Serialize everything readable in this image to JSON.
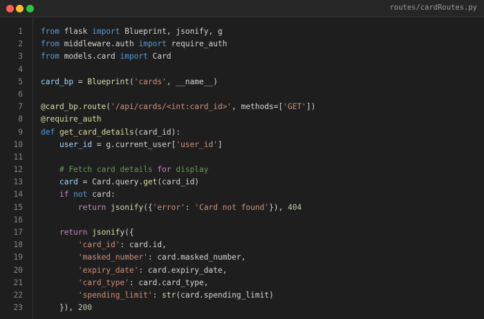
{
  "window": {
    "filename": "routes/cardRoutes.py",
    "colors": {
      "close": "#ff5f57",
      "minimize": "#febc2e",
      "maximize": "#28c840"
    }
  },
  "code": {
    "language": "python",
    "lines": [
      {
        "num": "1",
        "tokens": [
          [
            "kw",
            "from"
          ],
          [
            "t",
            " flask "
          ],
          [
            "kw",
            "import"
          ],
          [
            "t",
            " Blueprint, jsonify, g"
          ]
        ]
      },
      {
        "num": "2",
        "tokens": [
          [
            "kw",
            "from"
          ],
          [
            "t",
            " middleware.auth "
          ],
          [
            "kw",
            "import"
          ],
          [
            "t",
            " require_auth"
          ]
        ]
      },
      {
        "num": "3",
        "tokens": [
          [
            "kw",
            "from"
          ],
          [
            "t",
            " models.card "
          ],
          [
            "kw",
            "import"
          ],
          [
            "t",
            " Card"
          ]
        ]
      },
      {
        "num": "4",
        "tokens": []
      },
      {
        "num": "5",
        "tokens": [
          [
            "var",
            "card_bp"
          ],
          [
            "t",
            " = "
          ],
          [
            "fn",
            "Blueprint"
          ],
          [
            "t",
            "("
          ],
          [
            "str",
            "'cards'"
          ],
          [
            "t",
            ", __name__)"
          ]
        ]
      },
      {
        "num": "6",
        "tokens": []
      },
      {
        "num": "7",
        "tokens": [
          [
            "fn",
            "@card_bp.route"
          ],
          [
            "t",
            "("
          ],
          [
            "str",
            "'/api/cards/<int:card_id>'"
          ],
          [
            "t",
            ", methods=["
          ],
          [
            "str",
            "'GET'"
          ],
          [
            "t",
            "])"
          ]
        ]
      },
      {
        "num": "8",
        "tokens": [
          [
            "fn",
            "@require_auth"
          ]
        ]
      },
      {
        "num": "9",
        "tokens": [
          [
            "kw",
            "def"
          ],
          [
            "t",
            " "
          ],
          [
            "fn",
            "get_card_details"
          ],
          [
            "t",
            "(card_id):"
          ]
        ]
      },
      {
        "num": "10",
        "tokens": [
          [
            "t",
            "    "
          ],
          [
            "var",
            "user_id"
          ],
          [
            "t",
            " = g.current_user["
          ],
          [
            "str",
            "'user_id'"
          ],
          [
            "t",
            "]"
          ]
        ]
      },
      {
        "num": "11",
        "tokens": []
      },
      {
        "num": "12",
        "tokens": [
          [
            "t",
            "    "
          ],
          [
            "cm",
            "# Fetch card details "
          ],
          [
            "ctl",
            "for"
          ],
          [
            "cm",
            " display"
          ]
        ]
      },
      {
        "num": "13",
        "tokens": [
          [
            "t",
            "    "
          ],
          [
            "var",
            "card"
          ],
          [
            "t",
            " = Card.query."
          ],
          [
            "fn",
            "get"
          ],
          [
            "t",
            "(card_id)"
          ]
        ]
      },
      {
        "num": "14",
        "tokens": [
          [
            "t",
            "    "
          ],
          [
            "ctl",
            "if"
          ],
          [
            "t",
            " "
          ],
          [
            "kw",
            "not"
          ],
          [
            "t",
            " card:"
          ]
        ]
      },
      {
        "num": "15",
        "tokens": [
          [
            "t",
            "        "
          ],
          [
            "ctl",
            "return"
          ],
          [
            "t",
            " "
          ],
          [
            "fn",
            "jsonify"
          ],
          [
            "t",
            "({"
          ],
          [
            "str",
            "'error'"
          ],
          [
            "t",
            ": "
          ],
          [
            "str",
            "'Card not found'"
          ],
          [
            "t",
            "}), "
          ],
          [
            "num",
            "404"
          ]
        ]
      },
      {
        "num": "16",
        "tokens": []
      },
      {
        "num": "17",
        "tokens": [
          [
            "t",
            "    "
          ],
          [
            "ctl",
            "return"
          ],
          [
            "t",
            " "
          ],
          [
            "fn",
            "jsonify"
          ],
          [
            "t",
            "({"
          ]
        ]
      },
      {
        "num": "18",
        "tokens": [
          [
            "t",
            "        "
          ],
          [
            "str",
            "'card_id'"
          ],
          [
            "t",
            ": card.id,"
          ]
        ]
      },
      {
        "num": "19",
        "tokens": [
          [
            "t",
            "        "
          ],
          [
            "str",
            "'masked_number'"
          ],
          [
            "t",
            ": card.masked_number,"
          ]
        ]
      },
      {
        "num": "20",
        "tokens": [
          [
            "t",
            "        "
          ],
          [
            "str",
            "'expiry_date'"
          ],
          [
            "t",
            ": card.expiry_date,"
          ]
        ]
      },
      {
        "num": "21",
        "tokens": [
          [
            "t",
            "        "
          ],
          [
            "str",
            "'card_type'"
          ],
          [
            "t",
            ": card.card_type,"
          ]
        ]
      },
      {
        "num": "22",
        "tokens": [
          [
            "t",
            "        "
          ],
          [
            "str",
            "'spending_limit'"
          ],
          [
            "t",
            ": "
          ],
          [
            "fn",
            "str"
          ],
          [
            "t",
            "(card.spending_limit)"
          ]
        ]
      },
      {
        "num": "23",
        "tokens": [
          [
            "t",
            "    }), "
          ],
          [
            "num",
            "200"
          ]
        ]
      }
    ]
  }
}
